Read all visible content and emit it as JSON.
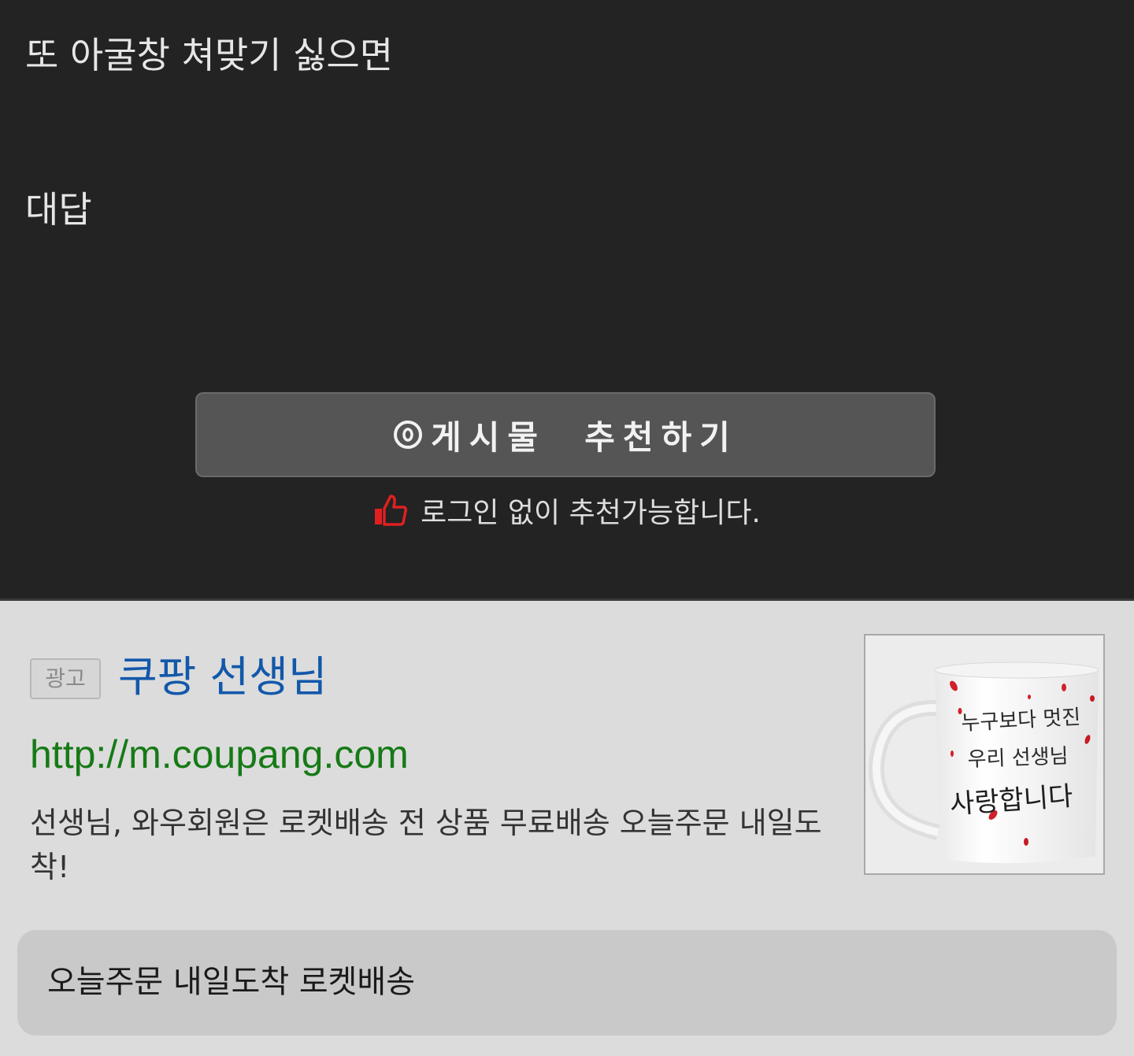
{
  "post": {
    "line1": "또 아굴창 쳐맞기 싫으면",
    "line2": "대답",
    "recommend_button_label": "게시물  추천하기",
    "login_note": "로그인 없이 추천가능합니다."
  },
  "ad": {
    "badge": "광고",
    "title": "쿠팡 선생님",
    "url": "http://m.coupang.com",
    "description": "선생님, 와우회원은 로켓배송 전 상품 무료배송 오늘주문 내일도착!",
    "mug_text": [
      "누구보다 멋진",
      "우리 선생님",
      "사랑합니다"
    ],
    "cta": "오늘주문 내일도착 로켓배송"
  },
  "colors": {
    "post_background": "#232323",
    "button_background": "#555555",
    "thumb_icon": "#e02020",
    "ad_background": "#dcdcdc",
    "ad_title": "#1258aa",
    "ad_url": "#167a16",
    "cta_background": "#c9c9c9"
  },
  "icons": {
    "recommend": "circle-dot-icon",
    "thumb": "thumbs-up-icon"
  }
}
